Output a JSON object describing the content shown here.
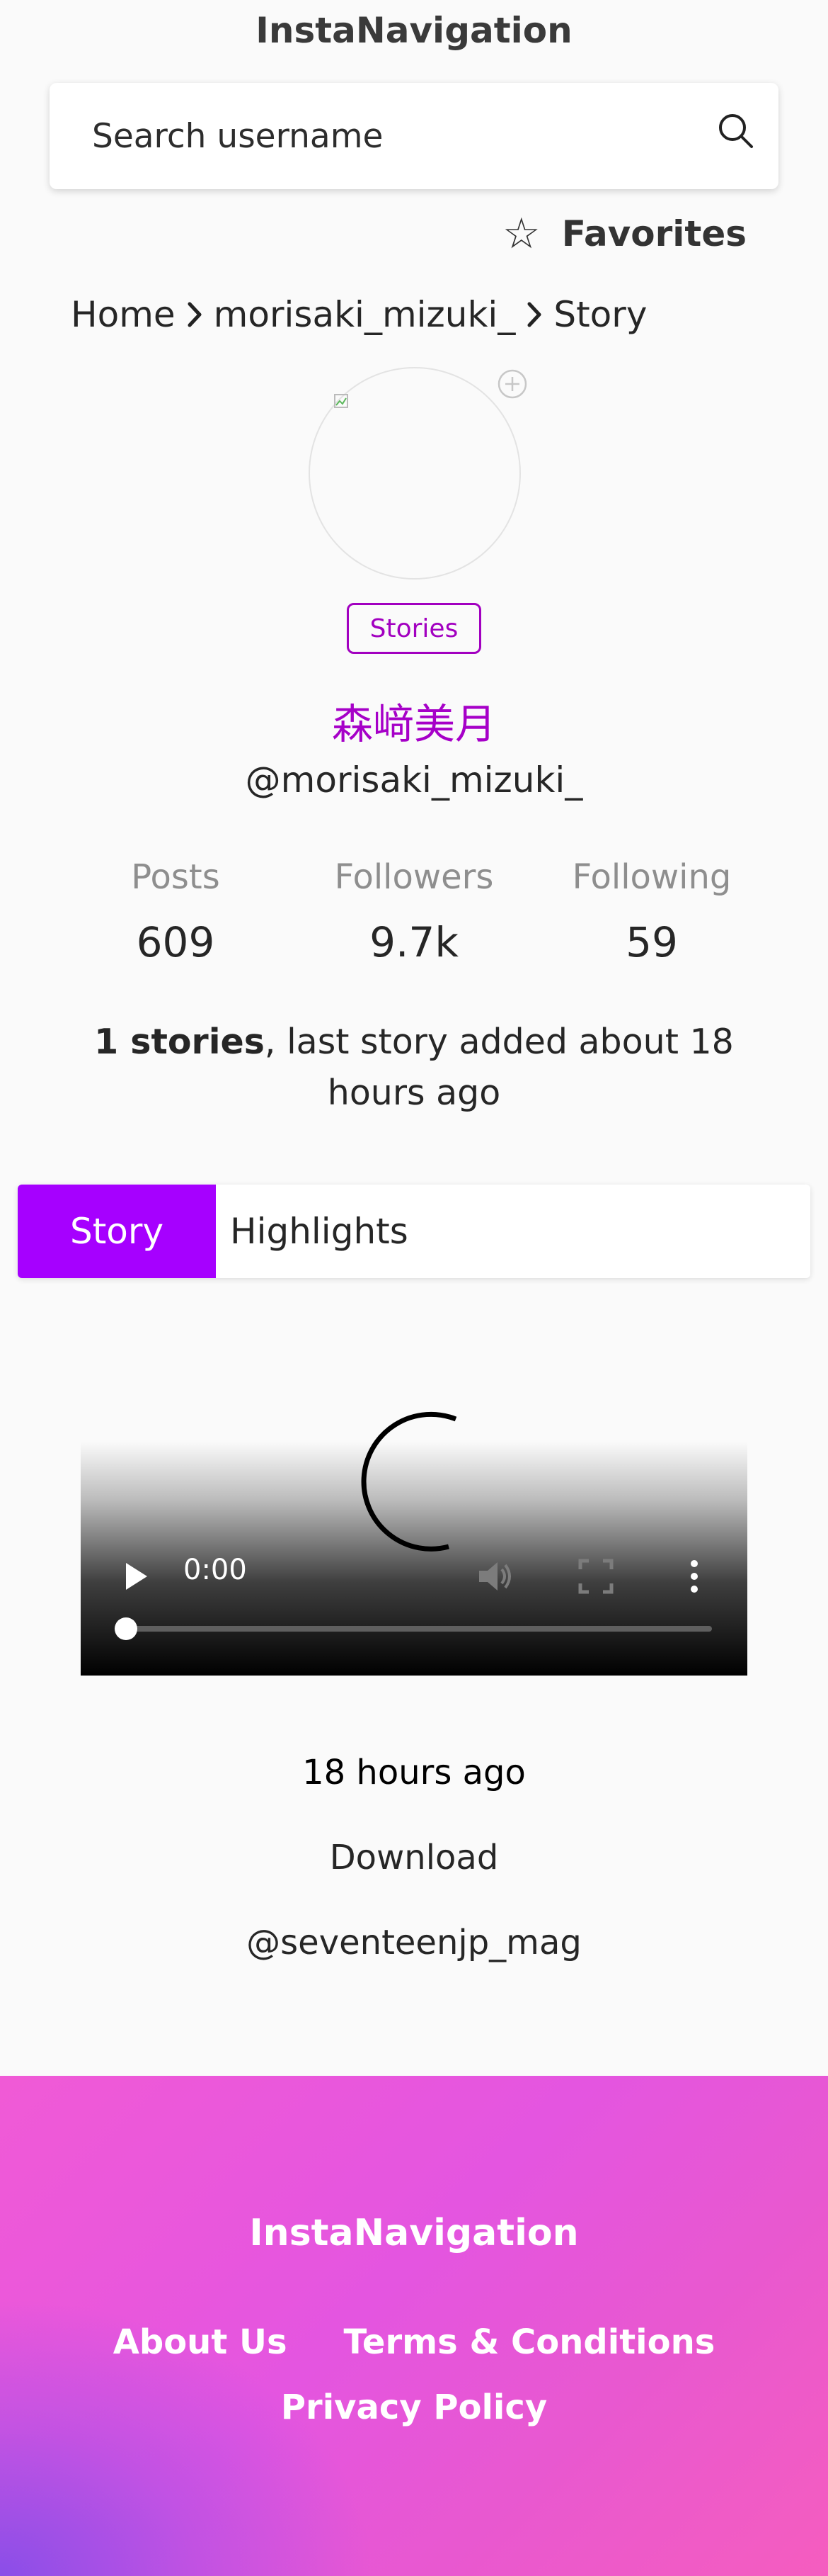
{
  "site": {
    "title": "InstaNavigation"
  },
  "search": {
    "placeholder": "Search username"
  },
  "favorites": {
    "label": "Favorites"
  },
  "breadcrumb": [
    "Home",
    "morisaki_mizuki_",
    "Story"
  ],
  "profile": {
    "stories_badge": "Stories",
    "full_name": "森﨑美月",
    "username": "@morisaki_mizuki_",
    "stats": [
      {
        "label": "Posts",
        "value": "609"
      },
      {
        "label": "Followers",
        "value": "9.7k"
      },
      {
        "label": "Following",
        "value": "59"
      }
    ],
    "summary_bold": "1 stories",
    "summary_rest": ", last story added about 18 hours ago"
  },
  "tabs": [
    {
      "label": "Story",
      "active": true
    },
    {
      "label": "Highlights",
      "active": false
    }
  ],
  "player": {
    "time": "0:00",
    "progress": 0
  },
  "story": {
    "ago": "18 hours ago",
    "download": "Download",
    "mention": "@seventeenjp_mag"
  },
  "footer": {
    "title": "InstaNavigation",
    "links": [
      "About Us",
      "Terms & Conditions",
      "Privacy Policy"
    ]
  },
  "colors": {
    "accent": "#a600ff",
    "name": "#a600c8",
    "badge": "#a200c0"
  }
}
